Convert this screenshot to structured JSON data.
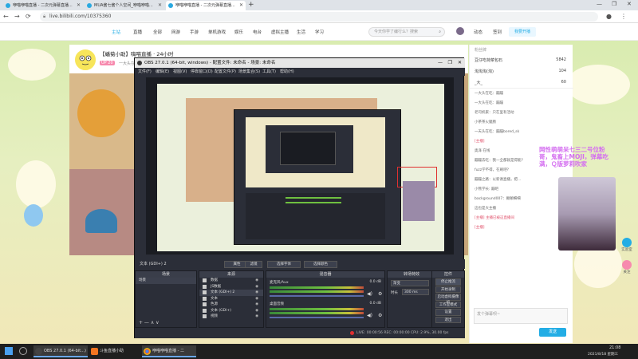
{
  "browser": {
    "tabs": [
      {
        "label": "咿喵咿喵直播 - 二次元弹幕直播..."
      },
      {
        "label": "MUA酱七酱个人空间_咿喵咿喵..."
      },
      {
        "label": "咿喵咿喵直播 - 二次元弹幕直播..."
      }
    ],
    "url": "live.bilibili.com/10375360"
  },
  "bili_header": {
    "nav": [
      "主站",
      "直播",
      "全部",
      "网游",
      "手游",
      "单机游戏",
      "娱乐",
      "电台",
      "虚拟主播",
      "生活",
      "学习"
    ],
    "search_placeholder": "今天你学了编行么？搜索",
    "right_links": [
      "动态",
      "签到",
      "我要开播"
    ]
  },
  "stream": {
    "title": "【蟠菊小助】嗨喵直播 · 24小时",
    "badge": "UP 20",
    "sub": "一大头在咨询..."
  },
  "rank": {
    "label": "粉丝牌",
    "items": [
      {
        "name": "豆仔吃荷菜包石",
        "value": "5842"
      },
      {
        "name": "淘淘淘(淘)",
        "value": "104"
      },
      {
        "name": "_大_",
        "value": "60"
      }
    ]
  },
  "chat": [
    "一大头在吃：蹦蹦",
    "一大头在吃：蹦蹦",
    "老司机家：只在里有活动",
    "小茶茶火腿肠",
    "一天头在吃：蹦蹦bored_sk",
    "[主播]",
    "奥泽 在线",
    "蹦蹦去吃：我一全都就是得能?",
    "fuzz学不得，在刷吧?",
    "蹦蹦之路：以新谢直播，把...",
    "小熊学长: 蹦吧",
    "background007：颠颠细细",
    "这也是大主播",
    "[主播] 主播已被这直播间",
    "[主播]"
  ],
  "chat_input_placeholder": "发个弹幕呗~",
  "send_label": "发送",
  "overlay_text": "网性萌萌呆七三二号位粉哥，鬼畜上MOJI，弹幕吃满，Ｑ版萝莉吹家",
  "float": {
    "a": "实验室",
    "b": "关注"
  },
  "obs": {
    "title": "OBS 27.0.1 (64-bit, windows) - 配置文件: 未命名 - 场景: 未命名",
    "menu": [
      "文件(F)",
      "编辑(E)",
      "视图(V)",
      "停靠窗口(D)",
      "配置文件(P)",
      "场景集合(S)",
      "工具(T)",
      "帮助(H)"
    ],
    "source_bar": {
      "label": "文本 (GDI+) 2",
      "buttons": [
        "属性",
        "滤镜",
        "选择字体",
        "选择颜色"
      ]
    },
    "docks": {
      "scenes": {
        "header": "场景",
        "items": [
          "场景"
        ]
      },
      "sources": {
        "header": "来源",
        "items": [
          "数据",
          "JS数据",
          "文本 (GDI+) 2",
          "文本",
          "色源",
          "文本 (GDI+)",
          "视频"
        ]
      },
      "mixer": {
        "header": "混音器",
        "tracks": [
          {
            "name": "麦克风/Aux",
            "db": "0.0 dB"
          },
          {
            "name": "桌面音频",
            "db": "0.0 dB"
          }
        ]
      },
      "transitions": {
        "header": "转场特效",
        "mode": "渐变",
        "duration_label": "时长",
        "duration": "300 ms"
      },
      "controls": {
        "header": "控件",
        "buttons": [
          "停止推流",
          "开始录制",
          "启动虚拟摄像机",
          "工作室模式",
          "设置",
          "退出"
        ]
      }
    },
    "status": "LIVE: 00:00:56   REC: 00:00:00   CPU: 2.9%, 30.00 fps"
  },
  "taskbar": {
    "items": [
      "OBS 27.0.1 (64-bit...)",
      "斗鱼直播小助",
      "咿喵咿喵直播 - 二"
    ],
    "time": "21:08",
    "date": "2021/8/18 星期三"
  },
  "colors": {
    "bili_blue": "#23ade5",
    "obs_bg": "#2b2e38",
    "overlay_purple": "#d46ef0"
  }
}
